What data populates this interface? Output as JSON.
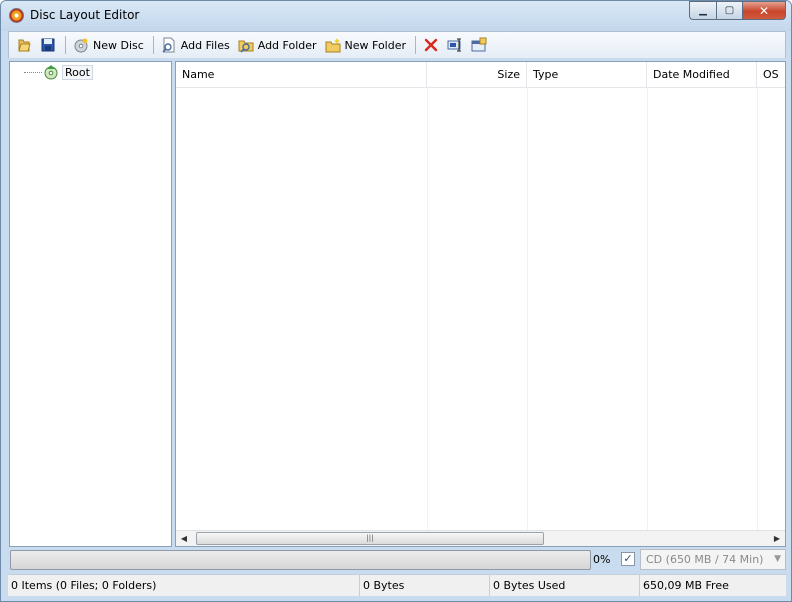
{
  "window": {
    "title": "Disc Layout Editor"
  },
  "toolbar": {
    "new_disc": "New Disc",
    "add_files": "Add Files",
    "add_folder": "Add Folder",
    "new_folder": "New Folder"
  },
  "tree": {
    "root": "Root"
  },
  "list": {
    "columns": {
      "name": "Name",
      "size": "Size",
      "type": "Type",
      "date": "Date Modified",
      "os": "OS"
    }
  },
  "progress": {
    "percent_label": "0%",
    "value": 0
  },
  "disc": {
    "selected": "CD (650 MB / 74 Min)",
    "enabled_checked": true
  },
  "status": {
    "items": "0 Items (0 Files; 0 Folders)",
    "bytes": "0 Bytes",
    "used": "0 Bytes Used",
    "free": "650,09 MB Free"
  },
  "colors": {
    "accent": "#c9dcef",
    "close": "#c8452c"
  }
}
